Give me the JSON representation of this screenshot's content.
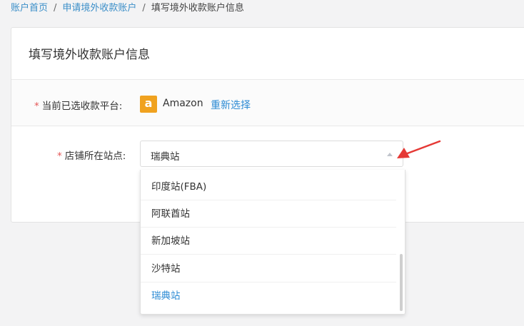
{
  "breadcrumb": {
    "home": "账户首页",
    "apply": "申请境外收款账户",
    "current": "填写境外收款账户信息",
    "sep": "/"
  },
  "card": {
    "title": "填写境外收款账户信息"
  },
  "platform": {
    "label": "当前已选收款平台:",
    "logo_letter": "a",
    "name": "Amazon",
    "reselect": "重新选择"
  },
  "store_site": {
    "label": "店铺所在站点:",
    "selected": "瑞典站",
    "options": [
      "印度站(FBA)",
      "阿联酋站",
      "新加坡站",
      "沙特站",
      "瑞典站"
    ]
  },
  "colors": {
    "link": "#2d8bd4",
    "required": "#e45656",
    "amazon_orange": "#f0a21f",
    "arrow": "#e53935"
  }
}
